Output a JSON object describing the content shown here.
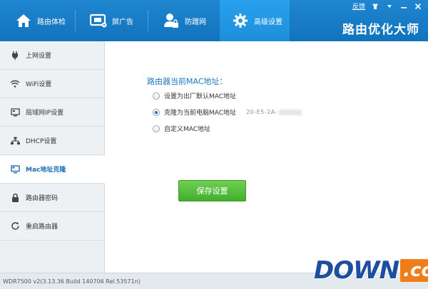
{
  "top_tabs": [
    {
      "label": "路由体检",
      "icon": "home-icon"
    },
    {
      "label": "屏广告",
      "icon": "screen-ad-icon"
    },
    {
      "label": "防蹭网",
      "icon": "user-lock-icon"
    },
    {
      "label": "高级设置",
      "icon": "gear-icon",
      "active": true
    }
  ],
  "top_links": {
    "feedback": "反馈"
  },
  "brand": "路由优化大师",
  "sidebar": {
    "items": [
      {
        "label": "上网设置",
        "icon": "plug-icon"
      },
      {
        "label": "WiFi设置",
        "icon": "wifi-icon"
      },
      {
        "label": "局域网IP设置",
        "icon": "lan-icon"
      },
      {
        "label": "DHCP设置",
        "icon": "network-tree-icon"
      },
      {
        "label": "Mac地址克隆",
        "icon": "monitor-icon",
        "active": true
      },
      {
        "label": "路由器密码",
        "icon": "lock-icon"
      },
      {
        "label": "重启路由器",
        "icon": "refresh-icon"
      }
    ]
  },
  "main": {
    "title": "路由器当前MAC地址：",
    "options": [
      {
        "label": "设置为出厂默认MAC地址",
        "checked": false
      },
      {
        "label": "克隆为当前电脑MAC地址",
        "checked": true,
        "value": "20-E5-2A-"
      },
      {
        "label": "自定义MAC地址",
        "checked": false
      }
    ],
    "save_label": "保存设置"
  },
  "status": {
    "version": "WDR7500 v2(3.13.36 Build 140706 Rel.53571n)"
  },
  "watermark": {
    "text": "DOWN",
    "suffix": ".cc"
  },
  "colors": {
    "accent": "#1273bd",
    "active_tab": "#2196e3",
    "save_button": "#4db535",
    "title_blue": "#1b78c3"
  }
}
